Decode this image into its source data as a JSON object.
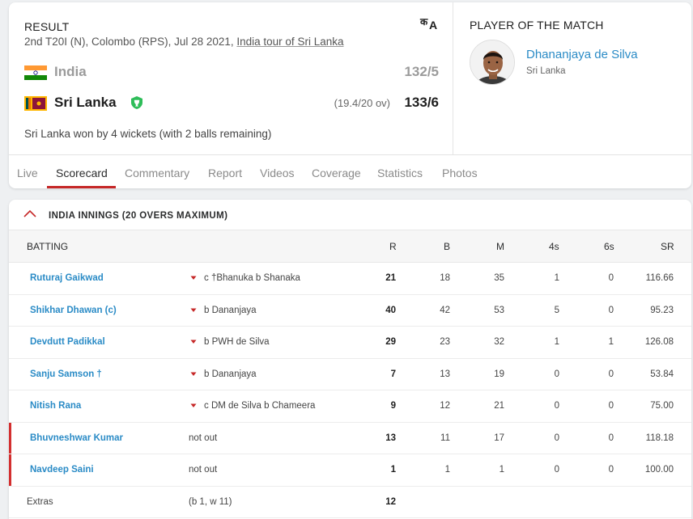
{
  "result": {
    "label": "RESULT",
    "match_info_prefix": "2nd T20I (N), Colombo (RPS), Jul 28 2021,",
    "series_link": "India tour of Sri Lanka",
    "teams": [
      {
        "name": "India",
        "overs": "",
        "score": "132/5"
      },
      {
        "name": "Sri Lanka",
        "overs": "(19.4/20 ov)",
        "score": "133/6"
      }
    ],
    "summary": "Sri Lanka won by 4 wickets (with 2 balls remaining)"
  },
  "player_of_match": {
    "title": "PLAYER OF THE MATCH",
    "name": "Dhananjaya de Silva",
    "team": "Sri Lanka"
  },
  "tabs": [
    "Live",
    "Scorecard",
    "Commentary",
    "Report",
    "Videos",
    "Coverage",
    "Statistics",
    "Photos"
  ],
  "active_tab": "Scorecard",
  "innings": {
    "title": "INDIA INNINGS (20 OVERS MAXIMUM)",
    "columns": {
      "batting": "BATTING",
      "r": "R",
      "b": "B",
      "m": "M",
      "fours": "4s",
      "sixes": "6s",
      "sr": "SR"
    },
    "batters": [
      {
        "name": "Ruturaj Gaikwad",
        "dismissal": "c †Bhanuka b Shanaka",
        "r": "21",
        "b": "18",
        "m": "35",
        "fours": "1",
        "sixes": "0",
        "sr": "116.66"
      },
      {
        "name": "Shikhar Dhawan (c)",
        "dismissal": "b Dananjaya",
        "r": "40",
        "b": "42",
        "m": "53",
        "fours": "5",
        "sixes": "0",
        "sr": "95.23"
      },
      {
        "name": "Devdutt Padikkal",
        "dismissal": "b PWH de Silva",
        "r": "29",
        "b": "23",
        "m": "32",
        "fours": "1",
        "sixes": "1",
        "sr": "126.08"
      },
      {
        "name": "Sanju Samson †",
        "dismissal": "b Dananjaya",
        "r": "7",
        "b": "13",
        "m": "19",
        "fours": "0",
        "sixes": "0",
        "sr": "53.84"
      },
      {
        "name": "Nitish Rana",
        "dismissal": "c DM de Silva b Chameera",
        "r": "9",
        "b": "12",
        "m": "21",
        "fours": "0",
        "sixes": "0",
        "sr": "75.00"
      },
      {
        "name": "Bhuvneshwar Kumar",
        "dismissal": "not out",
        "r": "13",
        "b": "11",
        "m": "17",
        "fours": "0",
        "sixes": "0",
        "sr": "118.18"
      },
      {
        "name": "Navdeep Saini",
        "dismissal": "not out",
        "r": "1",
        "b": "1",
        "m": "1",
        "fours": "0",
        "sixes": "0",
        "sr": "100.00"
      }
    ],
    "extras": {
      "label": "Extras",
      "detail": "(b 1, w 11)",
      "total": "12"
    }
  },
  "colors": {
    "link": "#2a8bc6",
    "accent": "#c62828",
    "not_out_marker": "#d32f2f",
    "win_badge": "#2ebd59"
  },
  "icons": [
    "language-toggle-icon",
    "india-flag-icon",
    "sri-lanka-flag-icon",
    "winner-badge-icon",
    "chevron-up-icon",
    "chevron-down-icon"
  ]
}
